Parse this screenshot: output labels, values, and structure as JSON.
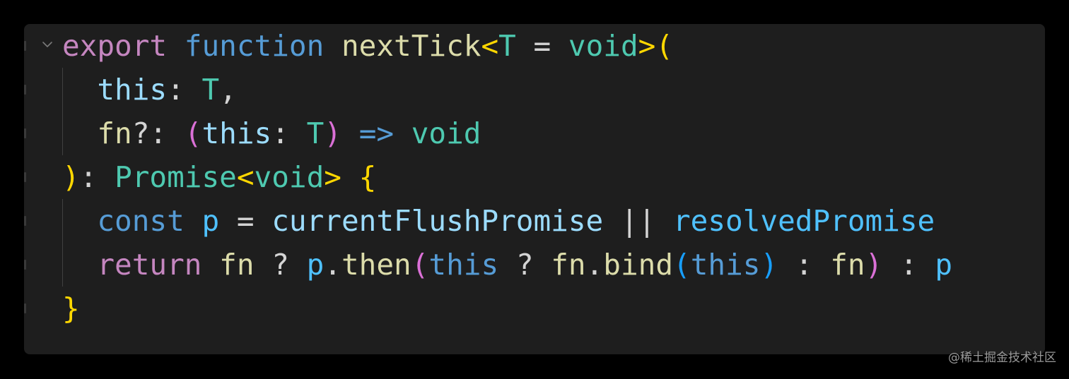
{
  "editor": {
    "fold_icon": "chevron-down-icon",
    "lines": [
      [
        {
          "t": "export",
          "c": "keyword"
        },
        {
          "t": " ",
          "c": "op"
        },
        {
          "t": "function",
          "c": "storage"
        },
        {
          "t": " ",
          "c": "op"
        },
        {
          "t": "nextTick",
          "c": "func"
        },
        {
          "t": "<",
          "c": "br1"
        },
        {
          "t": "T",
          "c": "type"
        },
        {
          "t": " = ",
          "c": "op"
        },
        {
          "t": "void",
          "c": "type"
        },
        {
          "t": ">",
          "c": "br1"
        },
        {
          "t": "(",
          "c": "br1"
        }
      ],
      [
        {
          "t": "  ",
          "c": "op"
        },
        {
          "t": "this",
          "c": "var"
        },
        {
          "t": ": ",
          "c": "op"
        },
        {
          "t": "T",
          "c": "type"
        },
        {
          "t": ",",
          "c": "op"
        }
      ],
      [
        {
          "t": "  ",
          "c": "op"
        },
        {
          "t": "fn",
          "c": "func"
        },
        {
          "t": "?: ",
          "c": "op"
        },
        {
          "t": "(",
          "c": "br2"
        },
        {
          "t": "this",
          "c": "var"
        },
        {
          "t": ": ",
          "c": "op"
        },
        {
          "t": "T",
          "c": "type"
        },
        {
          "t": ")",
          "c": "br2"
        },
        {
          "t": " ",
          "c": "op"
        },
        {
          "t": "=>",
          "c": "storage"
        },
        {
          "t": " ",
          "c": "op"
        },
        {
          "t": "void",
          "c": "type"
        }
      ],
      [
        {
          "t": ")",
          "c": "br1"
        },
        {
          "t": ": ",
          "c": "op"
        },
        {
          "t": "Promise",
          "c": "type"
        },
        {
          "t": "<",
          "c": "br1"
        },
        {
          "t": "void",
          "c": "type"
        },
        {
          "t": ">",
          "c": "br1"
        },
        {
          "t": " ",
          "c": "op"
        },
        {
          "t": "{",
          "c": "br1"
        }
      ],
      [
        {
          "t": "  ",
          "c": "op"
        },
        {
          "t": "const",
          "c": "storage"
        },
        {
          "t": " ",
          "c": "op"
        },
        {
          "t": "p",
          "c": "const"
        },
        {
          "t": " = ",
          "c": "op"
        },
        {
          "t": "currentFlushPromise",
          "c": "var"
        },
        {
          "t": " || ",
          "c": "op"
        },
        {
          "t": "resolvedPromise",
          "c": "const"
        }
      ],
      [
        {
          "t": "  ",
          "c": "op"
        },
        {
          "t": "return",
          "c": "keyword"
        },
        {
          "t": " ",
          "c": "op"
        },
        {
          "t": "fn",
          "c": "func"
        },
        {
          "t": " ? ",
          "c": "op"
        },
        {
          "t": "p",
          "c": "const"
        },
        {
          "t": ".",
          "c": "op"
        },
        {
          "t": "then",
          "c": "func"
        },
        {
          "t": "(",
          "c": "br2"
        },
        {
          "t": "this",
          "c": "storage"
        },
        {
          "t": " ? ",
          "c": "op"
        },
        {
          "t": "fn",
          "c": "func"
        },
        {
          "t": ".",
          "c": "op"
        },
        {
          "t": "bind",
          "c": "func"
        },
        {
          "t": "(",
          "c": "br3"
        },
        {
          "t": "this",
          "c": "storage"
        },
        {
          "t": ")",
          "c": "br3"
        },
        {
          "t": " : ",
          "c": "op"
        },
        {
          "t": "fn",
          "c": "func"
        },
        {
          "t": ")",
          "c": "br2"
        },
        {
          "t": " : ",
          "c": "op"
        },
        {
          "t": "p",
          "c": "const"
        }
      ],
      [
        {
          "t": "}",
          "c": "br1"
        }
      ]
    ]
  },
  "colors": {
    "background": "#000000",
    "editor_background": "#1e1e1e",
    "keyword": "#c586c0",
    "storage": "#569cd6",
    "function": "#dcdcaa",
    "type": "#4ec9b0",
    "variable": "#9cdcfe",
    "constant": "#4fc1ff",
    "bracket_level_1": "#ffd700",
    "bracket_level_2": "#da70d6",
    "bracket_level_3": "#179fff"
  },
  "watermark": {
    "text": "@稀土掘金技术社区"
  }
}
